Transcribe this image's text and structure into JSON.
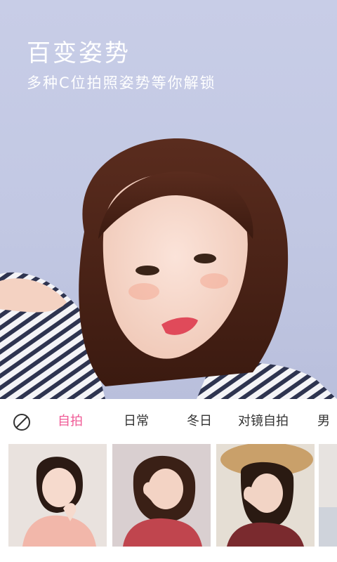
{
  "hero": {
    "title": "百变姿势",
    "subtitle": "多种C位拍照姿势等你解锁"
  },
  "tabs": {
    "none_icon": "prohibited-circle-icon",
    "items": [
      {
        "label": "自拍",
        "active": true
      },
      {
        "label": "日常",
        "active": false
      },
      {
        "label": "冬日",
        "active": false
      },
      {
        "label": "对镜自拍",
        "active": false
      },
      {
        "label": "男",
        "active": false
      }
    ]
  },
  "colors": {
    "accent": "#f05a96",
    "hero_bg": "#c8cde7",
    "text_dark": "#333333"
  }
}
